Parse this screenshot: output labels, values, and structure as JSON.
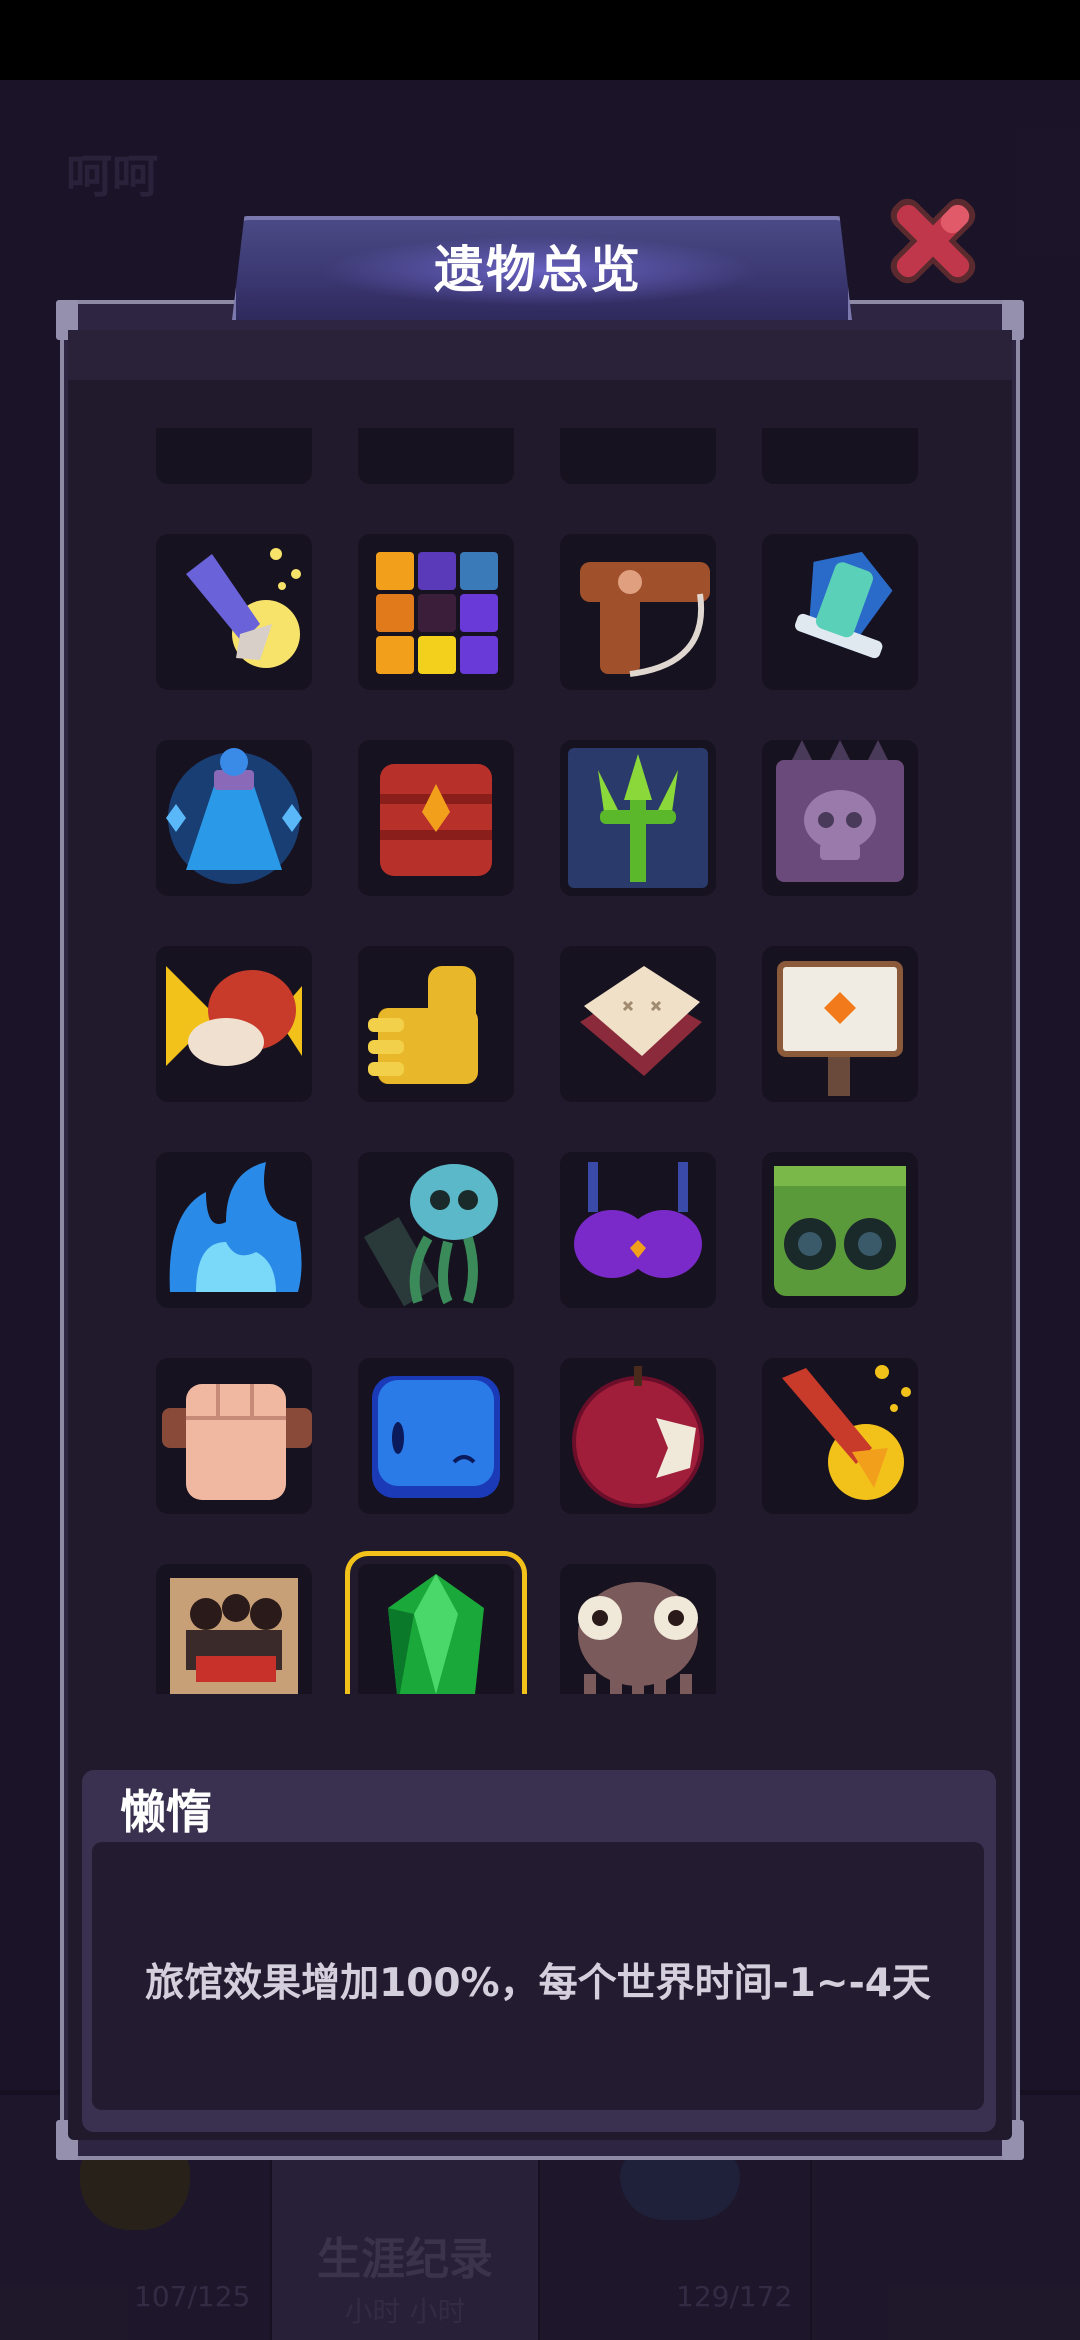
{
  "background": {
    "username": "呵呵",
    "bottom_nav": {
      "tab_career_label": "生涯纪录",
      "tab_career_sub": "小时 小时",
      "count_left": "107/125",
      "count_right": "129/172"
    }
  },
  "panel": {
    "title": "遗物总览"
  },
  "relic_grid": {
    "selected_index": 25,
    "items": [
      {
        "icon": "claw-weapon-icon"
      },
      {
        "icon": "coin-plate-icon"
      },
      {
        "icon": "green-creature-icon"
      },
      {
        "icon": "wooden-gear-icon"
      },
      {
        "icon": "magic-arrow-icon"
      },
      {
        "icon": "color-cube-icon"
      },
      {
        "icon": "hair-dryer-icon"
      },
      {
        "icon": "blue-sword-icon"
      },
      {
        "icon": "potion-flask-icon"
      },
      {
        "icon": "red-armor-icon"
      },
      {
        "icon": "green-trident-icon"
      },
      {
        "icon": "skull-block-icon"
      },
      {
        "icon": "meat-steak-icon"
      },
      {
        "icon": "thumbs-up-icon"
      },
      {
        "icon": "pillow-icon"
      },
      {
        "icon": "signpost-icon"
      },
      {
        "icon": "blue-flame-icon"
      },
      {
        "icon": "tentacle-skull-icon"
      },
      {
        "icon": "purple-bra-icon"
      },
      {
        "icon": "green-speaker-icon"
      },
      {
        "icon": "fist-icon"
      },
      {
        "icon": "blue-slime-icon"
      },
      {
        "icon": "bitten-apple-icon"
      },
      {
        "icon": "flame-arrow-icon"
      },
      {
        "icon": "poster-icon"
      },
      {
        "icon": "green-crystal-icon"
      },
      {
        "icon": "octopus-icon"
      }
    ]
  },
  "description": {
    "name": "懒惰",
    "text": "旅馆效果增加100%，每个世界时间-1~-4天"
  },
  "colors": {
    "selection_outline": "#f2c21b",
    "close_button": "#c0364a"
  }
}
